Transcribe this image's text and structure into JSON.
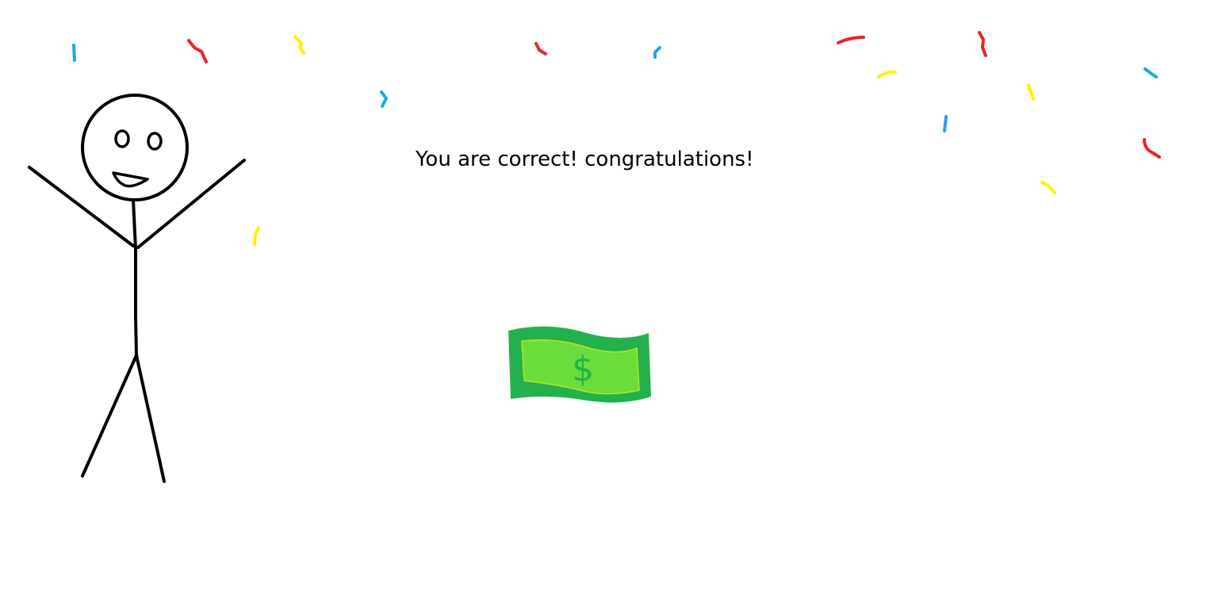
{
  "message": {
    "text": "You are correct! congratulations!"
  },
  "colors": {
    "background": "#ffffff",
    "stick_figure": "#000000",
    "confetti_red": "#e8242b",
    "confetti_yellow": "#fff200",
    "confetti_blue": "#1fa7e0",
    "bill_border": "#22b14c",
    "bill_fill": "#6bdd3a"
  },
  "icons": {
    "figure": "stick-figure-icon",
    "money": "dollar-bill-icon",
    "confetti": "confetti-icon"
  },
  "bill": {
    "symbol": "$"
  }
}
